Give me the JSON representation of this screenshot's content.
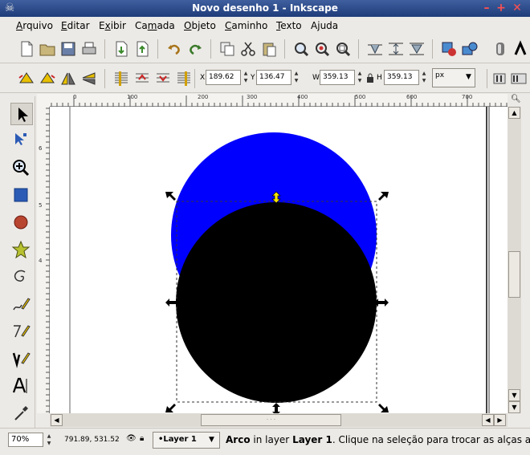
{
  "window": {
    "title": "Novo desenho 1 - Inkscape"
  },
  "menu": [
    {
      "label": "Arquivo",
      "u": "A",
      "rest": "rquivo"
    },
    {
      "label": "Editar",
      "u": "E",
      "rest": "ditar"
    },
    {
      "label": "Exibir",
      "u": "x",
      "pre": "E",
      "rest": "ibir"
    },
    {
      "label": "Camada",
      "u": "m",
      "pre": "Ca",
      "rest": "ada"
    },
    {
      "label": "Objeto",
      "u": "O",
      "rest": "bjeto"
    },
    {
      "label": "Caminho",
      "u": "C",
      "rest": "aminho"
    },
    {
      "label": "Texto",
      "u": "T",
      "rest": "exto"
    },
    {
      "label": "Ajuda",
      "u": "j",
      "pre": "A",
      "rest": "uda"
    }
  ],
  "controls": {
    "x_label": "X",
    "x_value": "189.62",
    "y_label": "Y",
    "y_value": "136.47",
    "w_label": "W",
    "w_value": "359.13",
    "h_label": "H",
    "h_value": "359.13",
    "unit": "px"
  },
  "rulers": {
    "h_ticks": [
      "0",
      "100",
      "200",
      "300",
      "400",
      "500",
      "600",
      "700"
    ],
    "v_ticks": [
      "6",
      "5",
      "4"
    ]
  },
  "status": {
    "zoom": "70%",
    "coords": "791.89, 531.52",
    "layer": "•Layer 1",
    "message_obj": "Arco",
    "message_mid": " in layer ",
    "message_layer": "Layer 1",
    "message_rest": ". Clique na seleção para trocar as alças amp"
  },
  "colors": {
    "blue_circle": "#0000ff",
    "black_circle": "#000000",
    "titlebar": "#2a4a8c"
  }
}
